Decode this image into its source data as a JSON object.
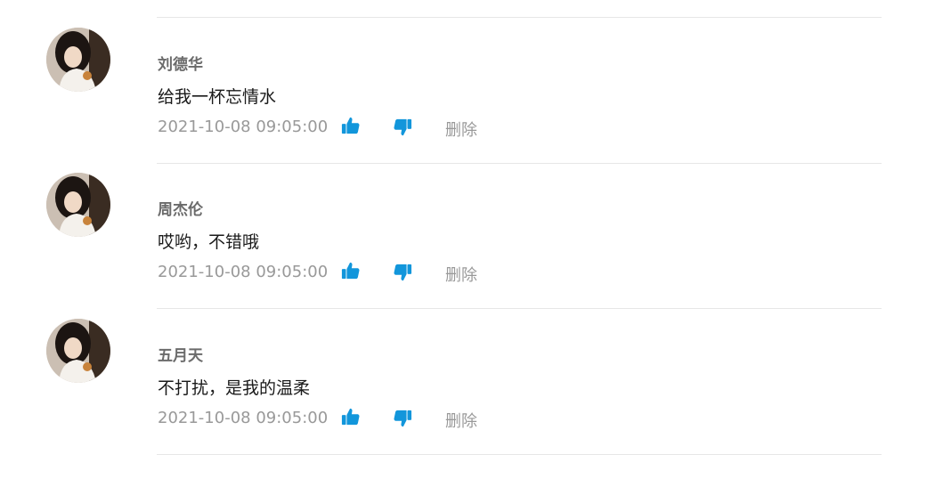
{
  "comments": [
    {
      "user": "刘德华",
      "content": "给我一杯忘情水",
      "time": "2021-10-08 09:05:00",
      "delete_label": "删除"
    },
    {
      "user": "周杰伦",
      "content": "哎哟，不错哦",
      "time": "2021-10-08 09:05:00",
      "delete_label": "删除"
    },
    {
      "user": "五月天",
      "content": "不打扰，是我的温柔",
      "time": "2021-10-08 09:05:00",
      "delete_label": "删除"
    }
  ],
  "icons": {
    "like": "thumbs-up-icon",
    "dislike": "thumbs-down-icon"
  },
  "colors": {
    "icon_accent": "#1296db",
    "meta_text": "#999999",
    "username": "#6b6b6b",
    "divider": "#e6e6e6"
  }
}
